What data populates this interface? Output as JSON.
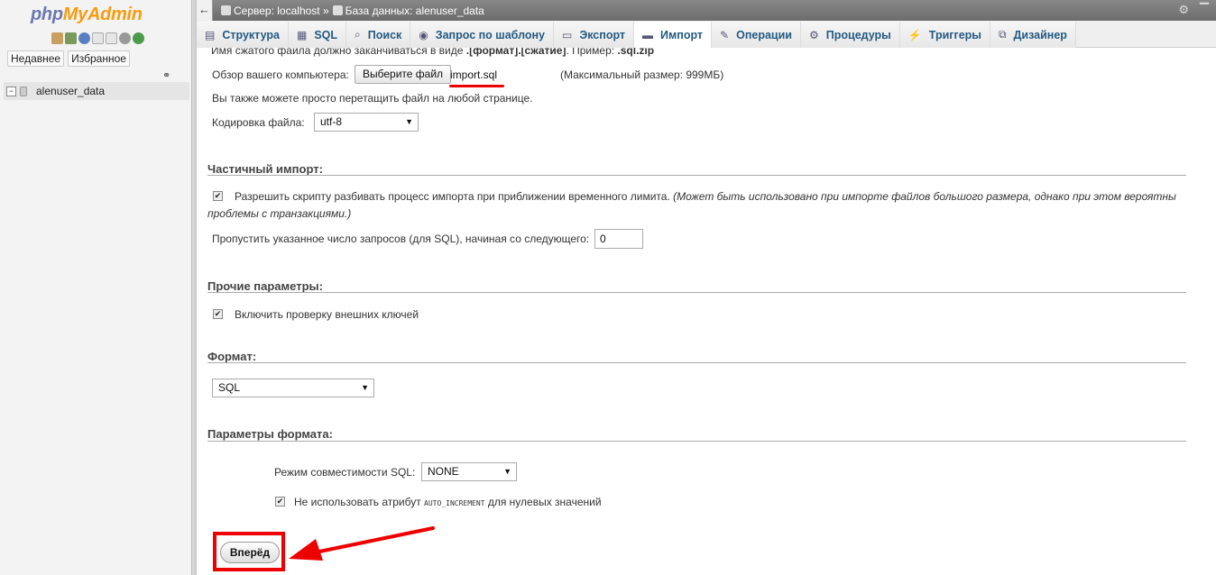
{
  "nav": {
    "logo_a": "php",
    "logo_b": "MyAdmin",
    "recent_label": "Недавнее",
    "favorites_label": "Избранное",
    "db_name": "alenuser_data"
  },
  "breadcrumb": {
    "server": "Сервер: localhost »",
    "database": "База данных: alenuser_data"
  },
  "tabs": [
    {
      "label": "Структура",
      "icon": "structure-icon"
    },
    {
      "label": "SQL",
      "icon": "sql-icon"
    },
    {
      "label": "Поиск",
      "icon": "search-icon"
    },
    {
      "label": "Запрос по шаблону",
      "icon": "query-icon"
    },
    {
      "label": "Экспорт",
      "icon": "export-icon"
    },
    {
      "label": "Импорт",
      "icon": "import-icon"
    },
    {
      "label": "Операции",
      "icon": "wrench-icon"
    },
    {
      "label": "Процедуры",
      "icon": "routines-icon"
    },
    {
      "label": "Триггеры",
      "icon": "triggers-icon"
    },
    {
      "label": "Дизайнер",
      "icon": "designer-icon"
    }
  ],
  "file": {
    "hint_prefix": "Имя сжатого файла должно заканчиваться в виде",
    "hint_format": ".[формат].[сжатие]",
    "hint_example_label": ". Пример:",
    "hint_example": ".sql.zip",
    "browse_label": "Обзор вашего компьютера:",
    "choose_button": "Выберите файл",
    "file_name": "import.sql",
    "max_size": "(Максимальный размер: 999МБ)",
    "drag_hint": "Вы также можете просто перетащить файл на любой странице.",
    "charset_label": "Кодировка файла:",
    "charset_value": "utf-8"
  },
  "partial": {
    "title": "Частичный импорт:",
    "allow_interrupt": "Разрешить скрипту разбивать процесс импорта при приближении временного лимита.",
    "allow_interrupt_note_1": "(Может быть использовано при импорте файлов большого размера, однако при этом вероятны",
    "allow_interrupt_note_2": "проблемы с транзакциями.)",
    "skip_label": "Пропустить указанное число запросов (для SQL), начиная со следующего:",
    "skip_value": "0"
  },
  "other": {
    "title": "Прочие параметры:",
    "fk_checks": "Включить проверку внешних ключей"
  },
  "format": {
    "title": "Формат:",
    "value": "SQL"
  },
  "format_options": {
    "title": "Параметры формата:",
    "compat_label": "Режим совместимости SQL:",
    "compat_value": "NONE",
    "no_auto_value_prefix": "Не использовать атрибут",
    "no_auto_value_code": "AUTO_INCREMENT",
    "no_auto_value_suffix": "для нулевых значений"
  },
  "submit_label": "Вперёд",
  "colors": {
    "highlight": "#e00000",
    "tab_text": "#235a81"
  }
}
